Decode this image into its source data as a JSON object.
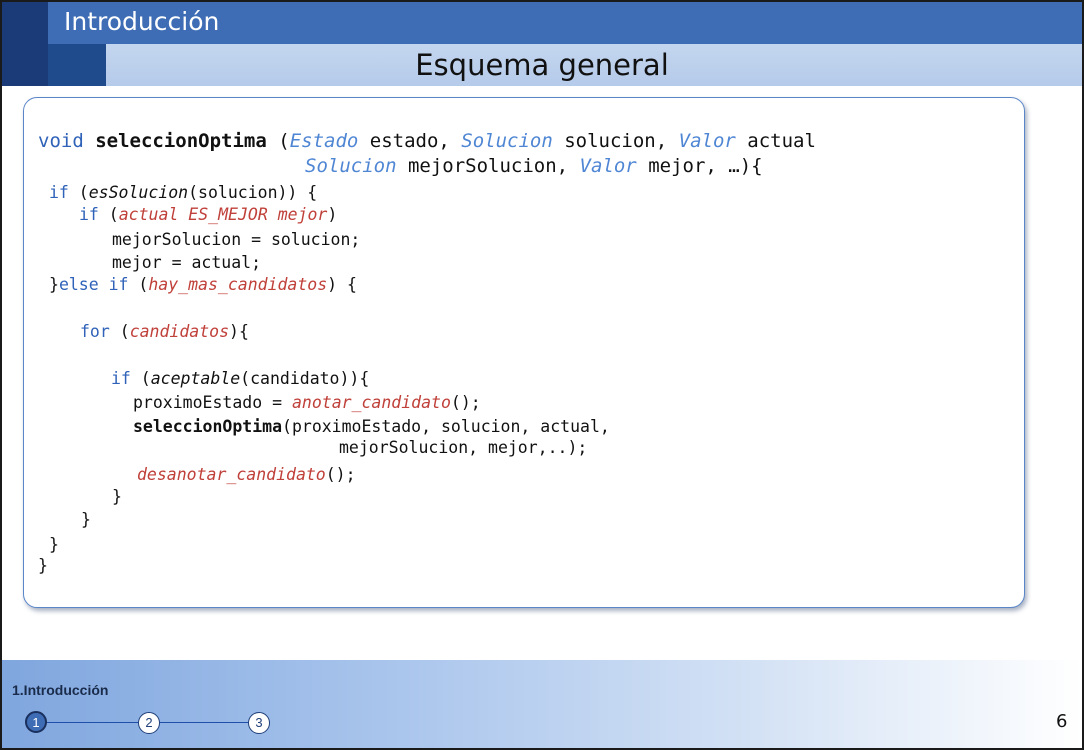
{
  "header": {
    "section": "Introducción",
    "title": "Esquema general"
  },
  "code": {
    "l1": {
      "a": "void ",
      "b": "seleccionOptima",
      "c": " (",
      "d": "Estado",
      "e": " estado, ",
      "f": "Solucion",
      "g": " solucion, ",
      "h": "Valor",
      "i": " actual"
    },
    "l2": {
      "a": "Solucion",
      "b": " mejorSolucion, ",
      "c": "Valor",
      "d": " mejor, …){"
    },
    "l3": {
      "a": "if",
      "b": " (",
      "c": "esSolucion",
      "d": "(solucion)) {"
    },
    "l4": {
      "a": "if",
      "b": " (",
      "c": "actual ES_MEJOR mejor",
      "d": ")"
    },
    "l5": "mejorSolucion = solucion;",
    "l6": "mejor = actual;",
    "l7": {
      "a": "}",
      "b": "else if",
      "c": " (",
      "d": "hay_mas_candidatos",
      "e": ") {"
    },
    "l8": {
      "a": "for",
      "b": " (",
      "c": "candidatos",
      "d": "){"
    },
    "l9": {
      "a": "if",
      "b": " (",
      "c": "aceptable",
      "d": "(candidato)){"
    },
    "l10": {
      "a": "proximoEstado = ",
      "b": "anotar_candidato",
      "c": "();"
    },
    "l11": {
      "a": "seleccionOptima",
      "b": "(proximoEstado, solucion, actual,"
    },
    "l12": "mejorSolucion, mejor,..);",
    "l13": {
      "a": "desanotar_candidato",
      "b": "();"
    },
    "l14": "}",
    "l15": "}",
    "l16": "}",
    "l17": "}"
  },
  "footer": {
    "section_label": "1.Introducción",
    "steps": [
      "1",
      "2",
      "3"
    ],
    "page_number": "6"
  },
  "colors": {
    "top_bar": "#3e6db5",
    "left_band": "#1b3a78",
    "subtitle_bar": "#b5cbea",
    "keyword": "#2f62b8",
    "type": "#4f86d4",
    "condition": "#c0403a"
  }
}
